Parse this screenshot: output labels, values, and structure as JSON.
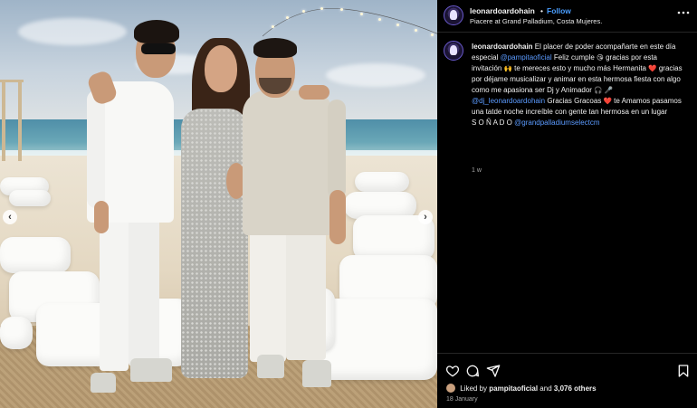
{
  "post": {
    "username": "leonardoardohain",
    "separator": "•",
    "follow_label": "Follow",
    "location": "Piacere at Grand Palladium, Costa Mujeres.",
    "more_icon": "more-horizontal-icon"
  },
  "caption": {
    "username": "leonardoardohain",
    "t1": "El placer de poder acompañarte en este día especial",
    "m1": "@pampitaoficial",
    "t2": "Feliz cumple",
    "e1": "😘",
    "t3": "gracias por esta invitación",
    "e2": "🙌",
    "t4": "te mereces esto y mucho más Hermanita",
    "e3": "❤️",
    "t5": "gracias por déjame musicalizar y animar en esta hermosa fiesta con algo como me apasiona ser Dj y Animador",
    "e4": "🎧",
    "e5": "🎤",
    "m2": "@dj_leonardoardohain",
    "t6": "Gracias Gracoas",
    "e6": "❤️",
    "t7": "te Amamos pasamos una tatde noche increíble con gente tan hermosa en un lugar",
    "t8": "S O Ñ A D O",
    "m3": "@grandpalladiumselectcm",
    "time": "1 w"
  },
  "actions": {
    "like_icon": "heart-icon",
    "comment_icon": "comment-icon",
    "share_icon": "share-icon",
    "save_icon": "bookmark-icon"
  },
  "likes": {
    "prefix": "Liked by",
    "user": "pampitaoficial",
    "middle": "and",
    "others": "3,076 others"
  },
  "date": "18 January",
  "media": {
    "prev_icon": "‹",
    "next_icon": "›"
  },
  "colors": {
    "background": "#000000",
    "link": "#4a9eff",
    "mention": "#5b9bff",
    "heart": "#ff3b3b",
    "muted": "#a8a8a8"
  }
}
